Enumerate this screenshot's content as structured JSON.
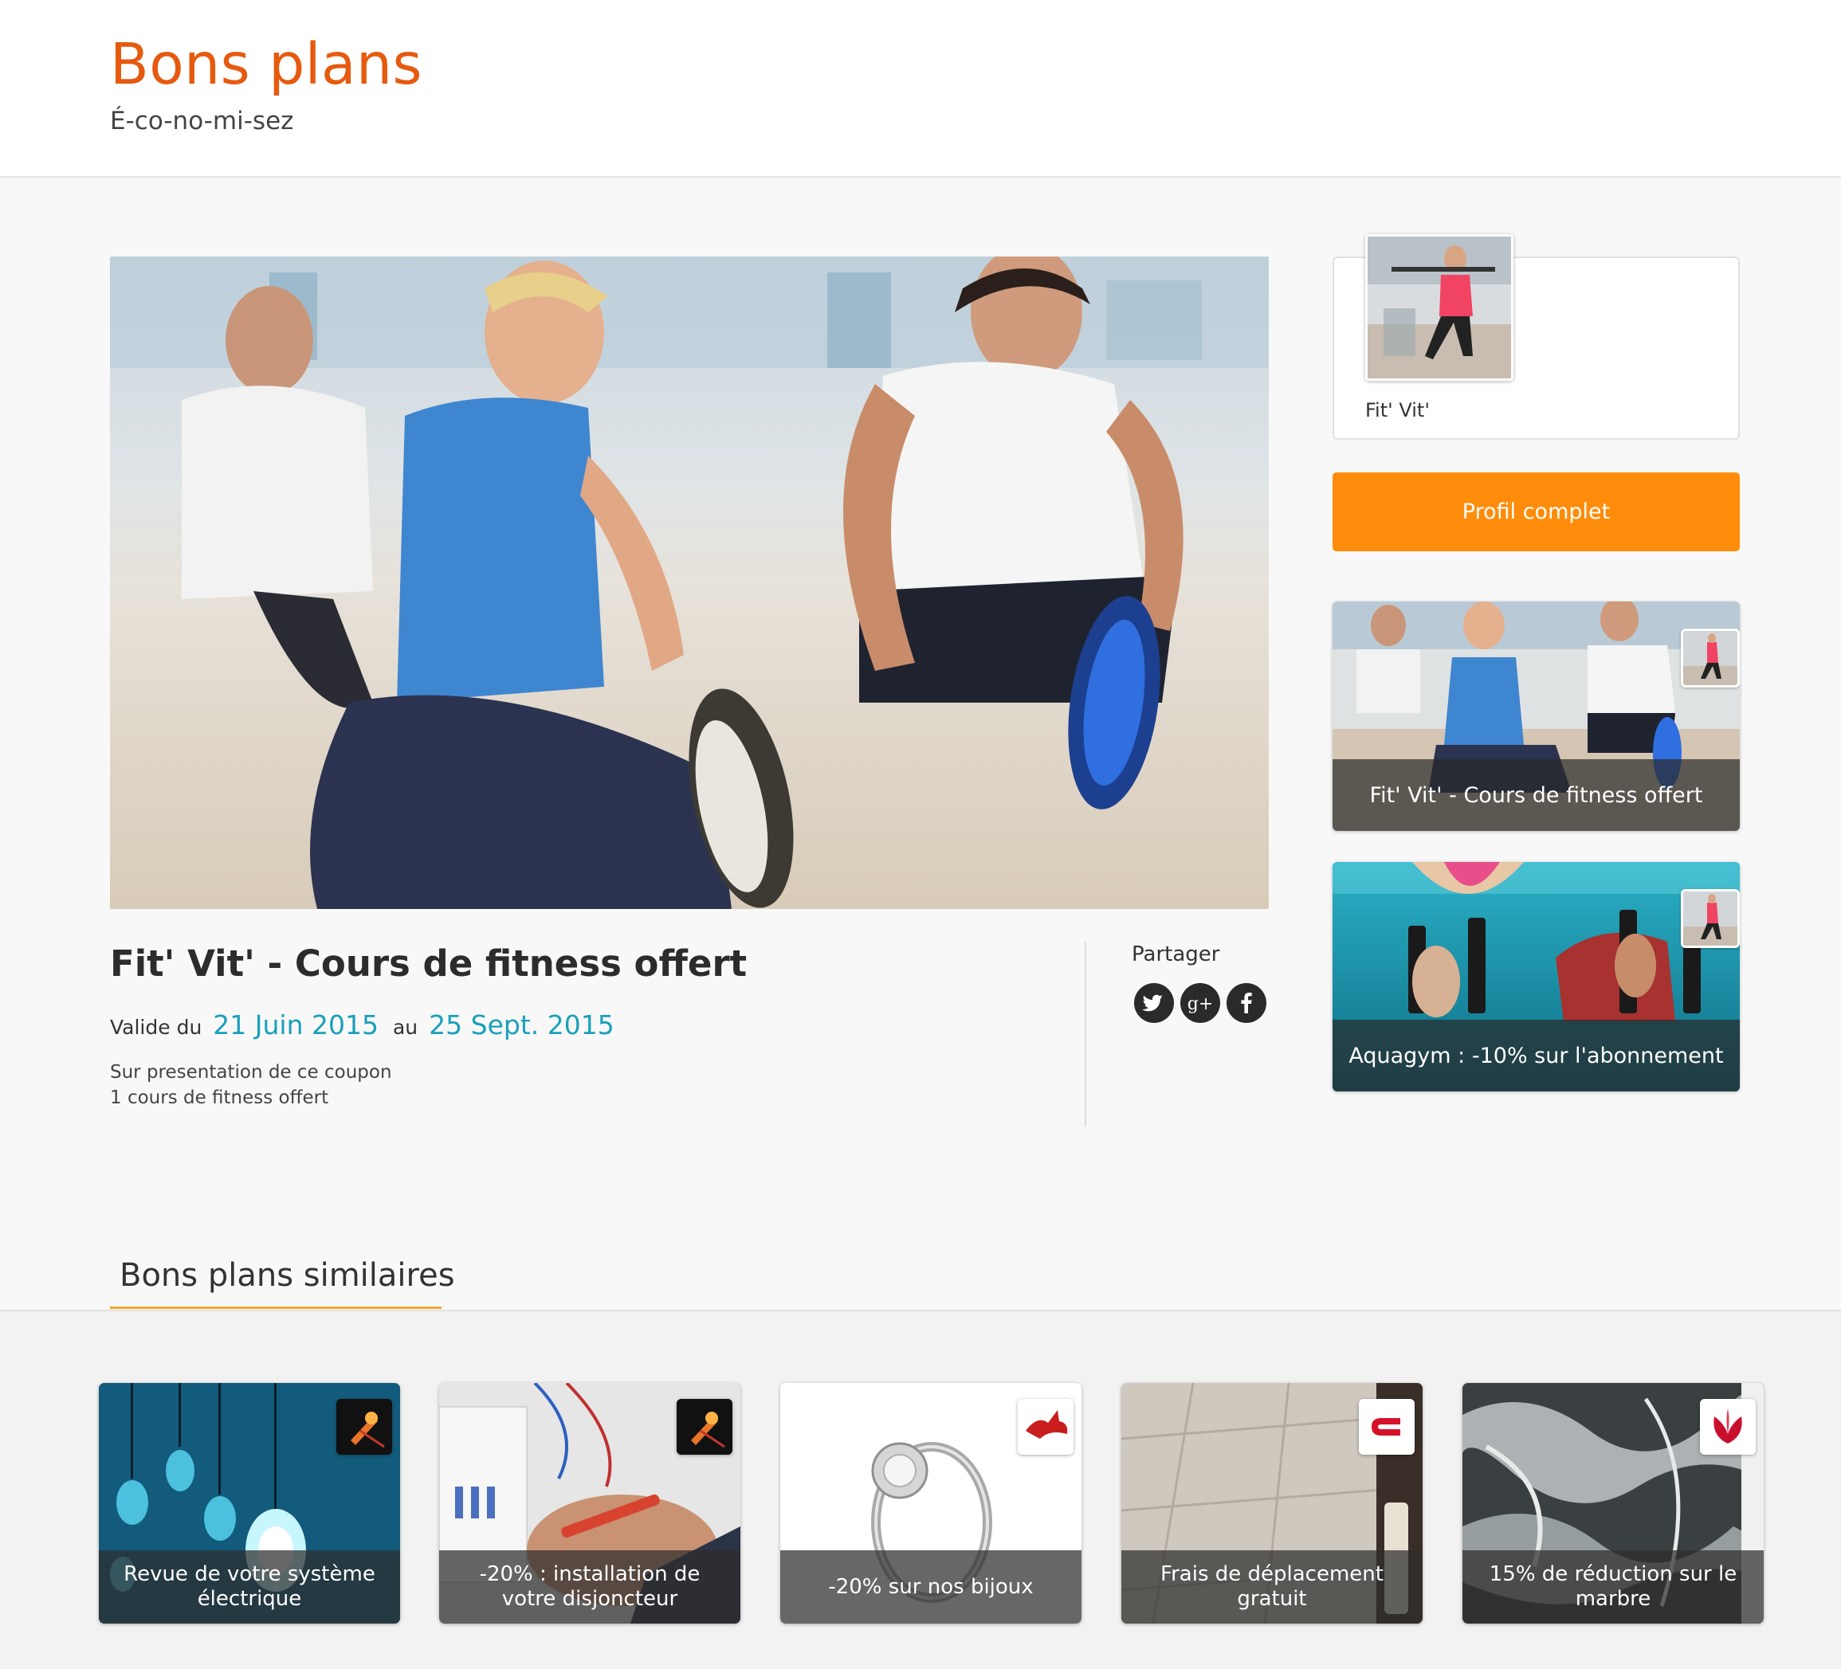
{
  "site": {
    "title": "Bons plans",
    "tagline": "É-co-no-mi-sez"
  },
  "deal": {
    "title": "Fit' Vit' - Cours de fitness offert",
    "valid_prefix": "Valide du",
    "valid_from": "21 Juin 2015",
    "valid_mid": "au",
    "valid_to": "25 Sept. 2015",
    "description": [
      "Sur presentation de ce coupon",
      "1 cours de fitness offert"
    ],
    "share_label": "Partager",
    "share_icons": [
      "twitter-icon",
      "google-plus-icon",
      "facebook-icon"
    ]
  },
  "merchant": {
    "name": "Fit' Vit'",
    "profile_button": "Profil complet"
  },
  "sidebar_deals": [
    {
      "caption": "Fit' Vit' - Cours de fitness offert"
    },
    {
      "caption": "Aquagym : -10% sur l'abonnement"
    }
  ],
  "similar": {
    "heading": "Bons plans similaires",
    "items": [
      {
        "caption": "Revue de votre système électrique"
      },
      {
        "caption": "-20% : installation de votre disjoncteur"
      },
      {
        "caption": "-20% sur nos bijoux"
      },
      {
        "caption": "Frais de déplacement gratuit"
      },
      {
        "caption": "15% de réduction sur le marbre"
      }
    ]
  },
  "colors": {
    "brand_orange": "#e65a0f",
    "button_orange": "#ff8c0a",
    "date_teal": "#1aa0b9",
    "underline": "#f0a830"
  }
}
